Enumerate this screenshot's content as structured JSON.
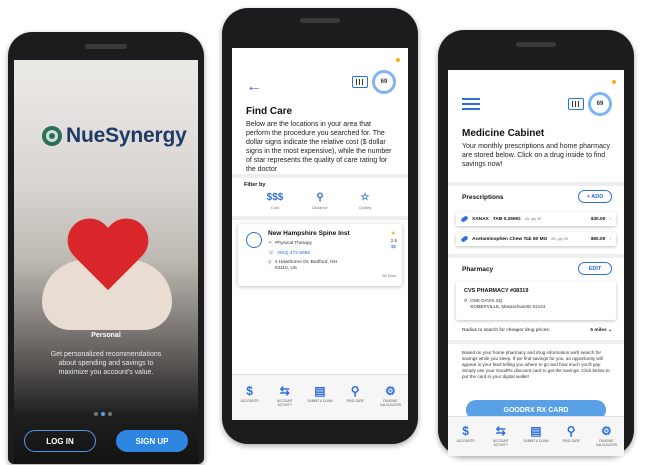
{
  "screen1": {
    "brand": "NueSynergy",
    "slide_title": "Personal",
    "slide_body": "Get personalized recommendations about spending and savings to maximize you account's value.",
    "login_label": "LOG IN",
    "signup_label": "SIGN UP",
    "pager_active_index": 1,
    "pager_count": 3
  },
  "screen2": {
    "score": "69",
    "title": "Find Care",
    "description": "Below are the locations in your area that perform the procedure you searched for. The dollar signs indicate the relative cost ($ dollar signs in the most expensive), while the number of star represents the quality of care rating for the doctor",
    "filter_label": "Filter by",
    "filters": [
      {
        "icon": "$$$",
        "label": "Cost"
      },
      {
        "icon": "distance-icon",
        "label": "Distance"
      },
      {
        "icon": "star-icon",
        "label": "Quality"
      }
    ],
    "result": {
      "name": "New Hampshire Spine Inst",
      "specialty": "Physical Therapy",
      "phone": "(603) 472-8686",
      "address_line1": "4 Hawthorne Dr, Bedford, NH",
      "address_line2": "03110, US",
      "rating": "2.5",
      "cost": "$$",
      "distance": "56 Dms"
    },
    "tabs": [
      {
        "label": "ACCOUNTS",
        "icon": "dollar-icon"
      },
      {
        "label": "ACCOUNT ACTIVITY",
        "icon": "transfer-icon"
      },
      {
        "label": "SUBMIT A CLAIM",
        "icon": "claim-icon"
      },
      {
        "label": "FIND CARE",
        "icon": "location-icon"
      },
      {
        "label": "FUNDING CALCULATOR",
        "icon": "calculator-icon"
      }
    ]
  },
  "screen3": {
    "score": "69",
    "title": "Medicine Cabinet",
    "description": "Your monthly prescriptions and home pharmacy are stored below. Click on a drug inside to find savings now!",
    "prescriptions_label": "Prescriptions",
    "add_label": "+ ADD",
    "prescriptions": [
      {
        "name": "XANAX",
        "dose": "TAB 0.25MG",
        "qty": "25, qty 30",
        "price": "$30.00"
      },
      {
        "name": "Acetaminophen Chew Tab 80 MG",
        "dose": "",
        "qty": "80, qty 30",
        "price": "$60.00"
      }
    ],
    "pharmacy_label": "Pharmacy",
    "edit_label": "EDIT",
    "pharmacy_name": "CVS PHARMACY #08319",
    "pharmacy_addr1": "ONE DAVIS SQ",
    "pharmacy_addr2": "SOMERVILLE, Massachusetts 02144",
    "radius_label": "Radius to search for cheaper drug prices:",
    "radius_value": "5 miles",
    "note": "Based on your home pharmacy and drug information we'll search for savings while you sleep. If we find savings for you, an opportunity will appear in your feed telling you where to go and how much you'll pay. Simply use your GoodRx discount card to get the savings. Click below to put the card in your digital wallet!",
    "cta_label": "GOODRX RX CARD",
    "tabs": [
      {
        "label": "ACCOUNTS",
        "icon": "dollar-icon"
      },
      {
        "label": "ACCOUNT ACTIVITY",
        "icon": "transfer-icon"
      },
      {
        "label": "SUBMIT A CLAIM",
        "icon": "claim-icon"
      },
      {
        "label": "FIND CARE",
        "icon": "location-icon"
      },
      {
        "label": "FUNDING CALCULATOR",
        "icon": "calculator-icon"
      }
    ]
  },
  "colors": {
    "accent": "#2d6fe0",
    "brand_navy": "#1f3a66",
    "heart_red": "#d9262b",
    "star": "#f5b31a"
  }
}
